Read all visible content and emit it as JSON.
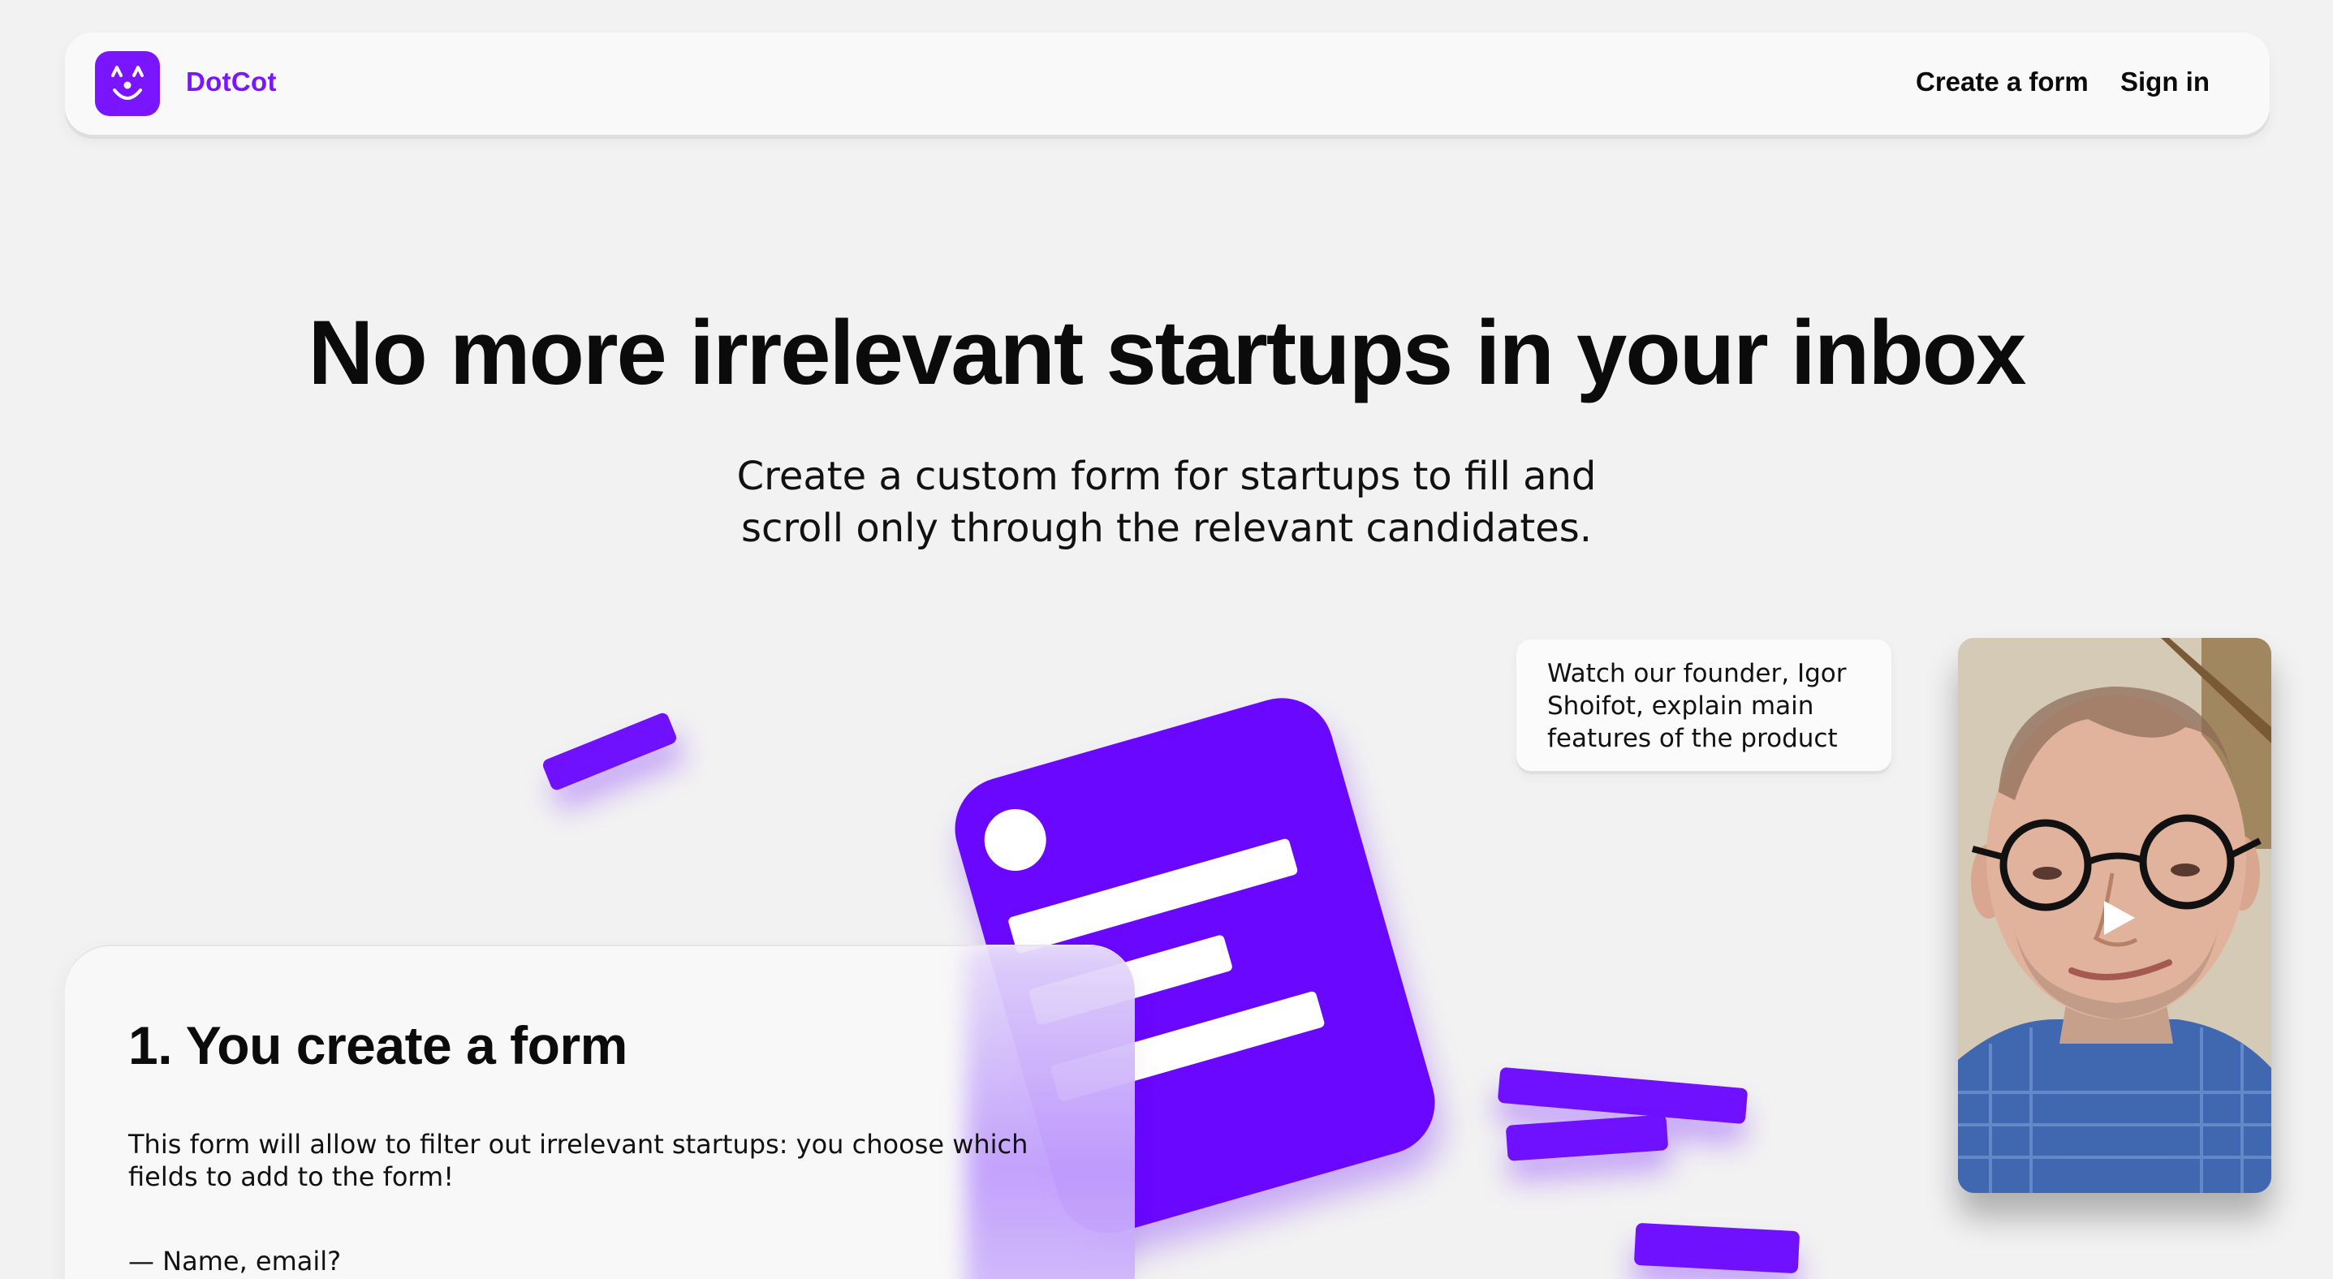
{
  "navbar": {
    "brand": "DotCot",
    "logo_icon": "smiling-cat-face-icon",
    "links": [
      {
        "label": "Create a form"
      },
      {
        "label": "Sign in"
      }
    ]
  },
  "hero": {
    "title": "No more irrelevant startups in your inbox",
    "subtitle_line1": "Create a custom form for startups to fill and",
    "subtitle_line2": "scroll only through the relevant candidates."
  },
  "video": {
    "caption_line1": "Watch our founder, Igor",
    "caption_line2": "Shoifot, explain main",
    "caption_line3": "features of the product",
    "play_icon": "play-icon"
  },
  "step": {
    "title": "1. You create a form",
    "description_line1": "This form will allow to filter out irrelevant startups: you choose which",
    "description_line2": "fields to add to the form!",
    "item": "— Name, email?"
  },
  "colors": {
    "accent": "#7a16ff",
    "background": "#f2f2f2",
    "card": "#f9f9f9",
    "text": "#0b0b0b"
  }
}
